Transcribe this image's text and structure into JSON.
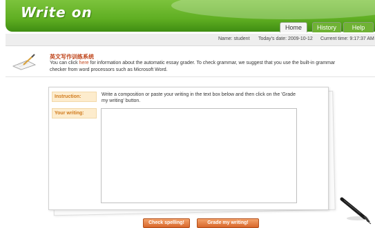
{
  "header": {
    "logo": "Write on",
    "tabs": [
      {
        "label": "Home",
        "active": true
      },
      {
        "label": "History",
        "active": false
      },
      {
        "label": "Help",
        "active": false
      }
    ]
  },
  "info": {
    "name": "Name: student",
    "date": "Today's date: 2009-10-12",
    "time": "Current time: 9:17:37 AM"
  },
  "notice": {
    "title": "英文写作训练系统",
    "text_before": "You can click ",
    "link": "here",
    "text_after": " for information about the automatic essay grader. To check grammar, we suggest that you use the built-in grammar checker from word processors such as Microsoft Word."
  },
  "form": {
    "instruction_label": "Instruction:",
    "instruction_text": "Write a composition or paste your writing in the text box below and then click on the 'Grade my writing' button.",
    "writing_label": "Your writing:",
    "writing_value": ""
  },
  "buttons": {
    "check_spelling": "Check spelling!",
    "grade": "Grade my writing!"
  },
  "colors": {
    "header_green": "#5fae22",
    "accent_orange": "#c0471d",
    "label_bg": "#fdeccd",
    "button_orange": "#e07a3c"
  }
}
